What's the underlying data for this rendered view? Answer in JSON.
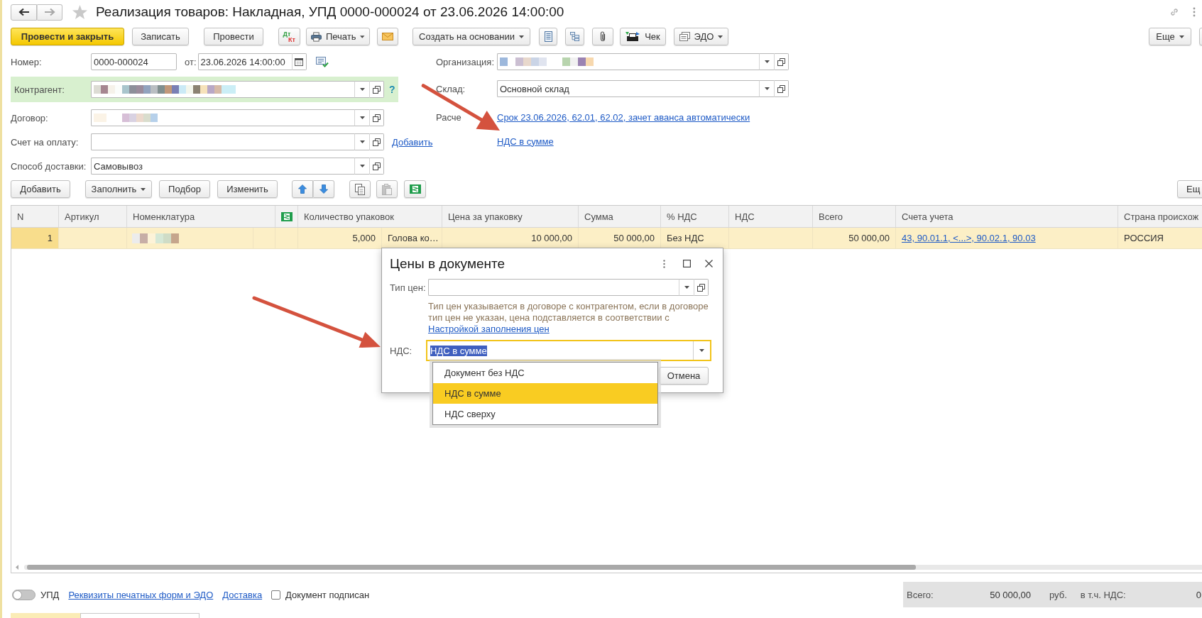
{
  "header": {
    "title": "Реализация товаров: Накладная, УПД 0000-000024 от 23.06.2026 14:00:00",
    "favorite": false,
    "back": {
      "disabled": false
    },
    "forward": {
      "disabled": true
    }
  },
  "toolbar": {
    "post_and_close": "Провести и закрыть",
    "save": "Записать",
    "post": "Провести",
    "ledger": {
      "debit": "Дт",
      "credit": "Кт"
    },
    "print": "Печать",
    "create_based_on": "Создать на основании",
    "receipt": "Чек",
    "edo": "ЭДО",
    "more": "Еще"
  },
  "form": {
    "number": {
      "label": "Номер:",
      "value": "0000-000024"
    },
    "date": {
      "label": "от:",
      "value": "23.06.2026 14:00:00"
    },
    "counterparty": {
      "label": "Контрагент:",
      "redacted": true,
      "highlighted": true,
      "help": "?"
    },
    "contract": {
      "label": "Договор:",
      "redacted": true
    },
    "invoice": {
      "label": "Счет на оплату:",
      "link": "Добавить"
    },
    "delivery": {
      "label": "Способ доставки:",
      "value": "Самовывоз"
    },
    "organization": {
      "label": "Организация:",
      "redacted": true
    },
    "warehouse": {
      "label": "Склад:",
      "value": "Основной склад"
    },
    "settlements": {
      "label": "Расче",
      "link": "Срок 23.06.2026, 62.01, 62.02, зачет аванса автоматически"
    },
    "vat_link": "НДС в сумме"
  },
  "table_toolbar": {
    "add": "Добавить",
    "fill": "Заполнить",
    "pick": "Подбор",
    "change": "Изменить",
    "paste": {
      "disabled": true
    },
    "more": "Ещ"
  },
  "table": {
    "columns": [
      {
        "kind": "text",
        "label": "N"
      },
      {
        "kind": "text",
        "label": "Артикул"
      },
      {
        "kind": "text",
        "label": "Номенклатура"
      },
      {
        "kind": "icon"
      },
      {
        "kind": "text",
        "label": "Количество упаковок"
      },
      {
        "kind": "text",
        "label": "Цена за упаковку"
      },
      {
        "kind": "text",
        "label": "Сумма"
      },
      {
        "kind": "text",
        "label": "% НДС"
      },
      {
        "kind": "text",
        "label": "НДС"
      },
      {
        "kind": "text",
        "label": "Всего"
      },
      {
        "kind": "text",
        "label": "Счета учета"
      },
      {
        "kind": "text",
        "label": "Страна происхож"
      }
    ],
    "rows": [
      {
        "selected": true,
        "n": "1",
        "nomenclature_redacted": true,
        "quantity": "5,000",
        "unit": "Голова ко…",
        "price": "10 000,00",
        "sum": "50 000,00",
        "vat_rate": "Без НДС",
        "total": "50 000,00",
        "accounts": "43, 90.01.1, <...>, 90.02.1, 90.03",
        "country": "РОССИЯ"
      }
    ]
  },
  "dialog": {
    "title": "Цены в документе",
    "price_type": {
      "label": "Тип цен:"
    },
    "hint": "Тип цен указывается в договоре с контрагентом, если в договоре тип цен не указан, цена подставляется в соответствии с",
    "hint_link": "Настройкой заполнения цен",
    "vat": {
      "label": "НДС:",
      "value": "НДС в сумме",
      "focused": true
    },
    "cancel": "Отмена",
    "options": [
      {
        "label": "Документ без НДС",
        "selected": false
      },
      {
        "label": "НДС в сумме",
        "selected": true
      },
      {
        "label": "НДС сверху",
        "selected": false
      }
    ]
  },
  "footer": {
    "upd": {
      "label": "УПД",
      "on": false
    },
    "links": [
      "Реквизиты печатных форм и ЭДО",
      "Доставка"
    ],
    "signed": {
      "label": "Документ подписан",
      "checked": false
    },
    "totals": {
      "total_label": "Всего:",
      "total": "50 000,00",
      "currency": "руб.",
      "vat_label": "в т.ч. НДС:",
      "vat": "0"
    }
  }
}
